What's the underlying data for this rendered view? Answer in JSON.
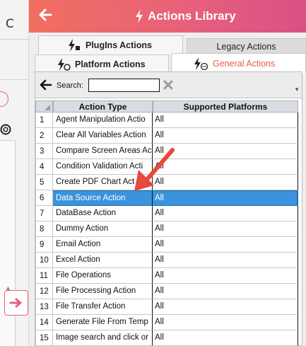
{
  "background_app": {
    "refresh_glyph": "C"
  },
  "header": {
    "title": "Actions Library",
    "back_icon": "arrow-left-icon",
    "title_icon": "lightning-icon"
  },
  "tabs": [
    {
      "label": "PlugIns Actions",
      "icon": "plugin-lightning-icon",
      "active": false
    },
    {
      "label": "Legacy Actions",
      "icon": "",
      "active": false
    },
    {
      "label": "Platform Actions",
      "icon": "platform-lightning-icon",
      "active": false
    },
    {
      "label": "General Actions",
      "icon": "general-lightning-icon",
      "active": true
    }
  ],
  "search": {
    "label": "Search:",
    "value": "",
    "placeholder": ""
  },
  "table": {
    "columns": [
      "Action Type",
      "Supported Platforms"
    ],
    "rows": [
      {
        "num": "1",
        "type": "Agent Manipulation Actio",
        "platform": "All"
      },
      {
        "num": "2",
        "type": "Clear All Variables Action",
        "platform": "All"
      },
      {
        "num": "3",
        "type": "Compare Screen Areas Ac",
        "platform": "All"
      },
      {
        "num": "4",
        "type": "Condition Validation Acti",
        "platform": "All"
      },
      {
        "num": "5",
        "type": "Create PDF Chart Act",
        "platform": "All"
      },
      {
        "num": "6",
        "type": "Data Source Action",
        "platform": "All"
      },
      {
        "num": "7",
        "type": "DataBase Action",
        "platform": "All"
      },
      {
        "num": "8",
        "type": "Dummy Action",
        "platform": "All"
      },
      {
        "num": "9",
        "type": "Email Action",
        "platform": "All"
      },
      {
        "num": "10",
        "type": "Excel Action",
        "platform": "All"
      },
      {
        "num": "11",
        "type": "File Operations",
        "platform": "All"
      },
      {
        "num": "12",
        "type": "File Processing Action",
        "platform": "All"
      },
      {
        "num": "13",
        "type": "File Transfer Action",
        "platform": "All"
      },
      {
        "num": "14",
        "type": "Generate File From Temp",
        "platform": "All"
      },
      {
        "num": "15",
        "type": "Image search and click or",
        "platform": "All"
      }
    ],
    "selected_row": "6"
  },
  "colors": {
    "accent": "#e8617a",
    "selection": "#3a93dc",
    "annotation_arrow": "#e8483e"
  }
}
